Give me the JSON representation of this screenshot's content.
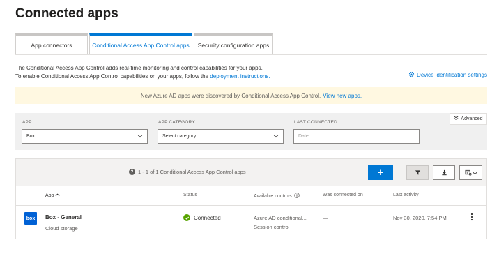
{
  "page": {
    "title": "Connected apps"
  },
  "tabs": [
    {
      "label": "App connectors",
      "active": false
    },
    {
      "label": "Conditional Access App Control apps",
      "active": true
    },
    {
      "label": "Security configuration apps",
      "active": false
    }
  ],
  "description": {
    "line1": "The Conditional Access App Control adds real-time monitoring and control capabilities for your apps.",
    "line2_prefix": "To enable Conditional Access App Control capabilities on your apps, follow the",
    "line2_link": "deployment instructions."
  },
  "device_settings_link": "Device identification settings",
  "banner": {
    "text": "New Azure AD apps were discovered by Conditional Access App Control.",
    "link": "View new apps."
  },
  "filters": {
    "advanced_label": "Advanced",
    "app": {
      "label": "APP",
      "value": "Box"
    },
    "category": {
      "label": "APP CATEGORY",
      "placeholder": "Select category..."
    },
    "last_connected": {
      "label": "LAST CONNECTED",
      "placeholder": "Date..."
    }
  },
  "toolbar": {
    "count_text": "1 - 1 of 1 Conditional Access App Control apps",
    "add_label": "+"
  },
  "table": {
    "columns": {
      "app": "App",
      "status": "Status",
      "controls": "Available controls",
      "was_connected": "Was connected on",
      "last_activity": "Last activity"
    },
    "rows": [
      {
        "logo_text": "box",
        "name": "Box - General",
        "category": "Cloud storage",
        "status": "Connected",
        "controls_line1": "Azure AD conditional...",
        "controls_line2": "Session control",
        "was_connected": "—",
        "last_activity": "Nov 30, 2020, 7:54 PM"
      }
    ]
  },
  "colors": {
    "accent": "#0078d4",
    "banner_bg": "#fff8e1",
    "status_green": "#57a300",
    "box_brand": "#0061d5"
  },
  "icons": {
    "device_settings": "gear-icon",
    "count_info": "info-icon",
    "status": "check-circle-icon",
    "filter": "funnel-icon",
    "download": "download-icon",
    "columns": "column-settings-icon",
    "row_menu": "more-vertical-icon"
  }
}
